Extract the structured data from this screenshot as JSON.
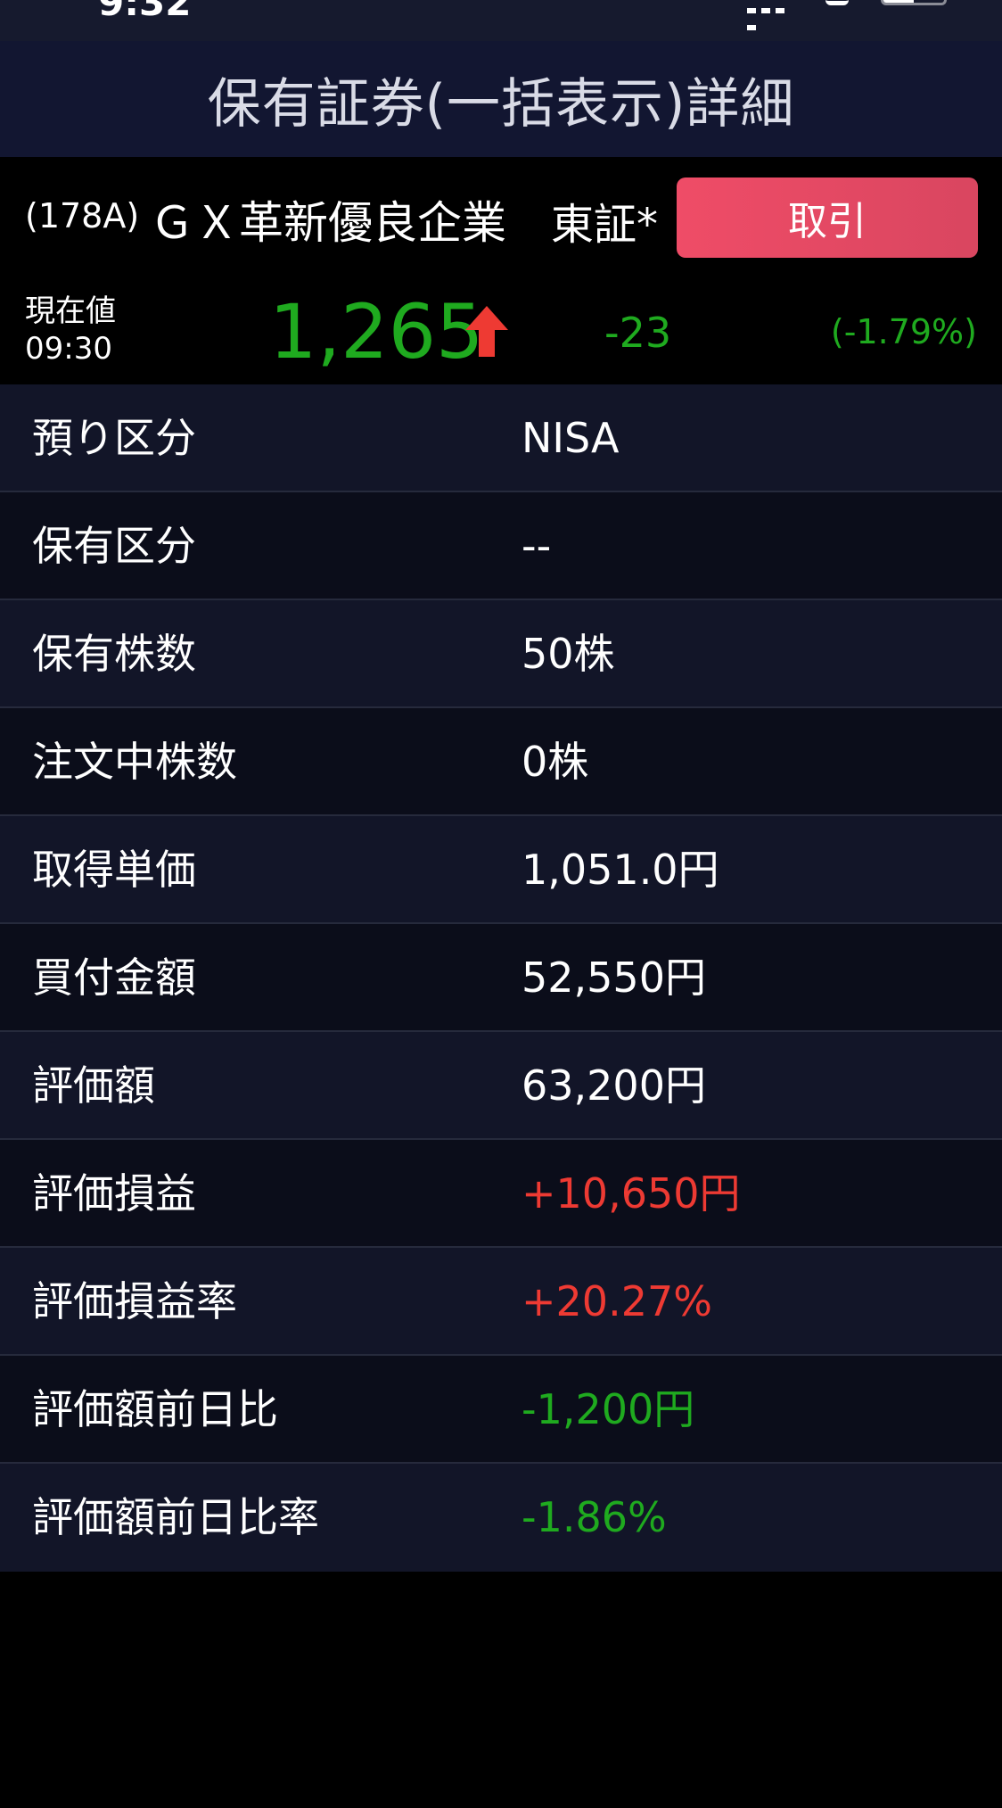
{
  "status_bar": {
    "time": "9:32"
  },
  "header": {
    "title": "保有証券(一括表示)詳細"
  },
  "stock": {
    "code": "(178A)",
    "name": "ＧＸ革新優良企業",
    "market": "東証*",
    "trade_button_label": "取引",
    "price_label": "現在値",
    "price_time": "09:30",
    "current_price": "1,265",
    "price_direction_icon": "up-arrow-icon",
    "change": "-23",
    "change_pct": "(-1.79%)",
    "colors": {
      "down": "#1faa1f",
      "up": "#ee3a33",
      "trade_button": "#ef4c67"
    }
  },
  "details": [
    {
      "label": "預り区分",
      "value": "NISA",
      "tone": "neutral"
    },
    {
      "label": "保有区分",
      "value": "--",
      "tone": "neutral"
    },
    {
      "label": "保有株数",
      "value": "50株",
      "tone": "neutral"
    },
    {
      "label": "注文中株数",
      "value": "0株",
      "tone": "neutral"
    },
    {
      "label": "取得単価",
      "value": "1,051.0円",
      "tone": "neutral"
    },
    {
      "label": "買付金額",
      "value": "52,550円",
      "tone": "neutral"
    },
    {
      "label": "評価額",
      "value": "63,200円",
      "tone": "neutral"
    },
    {
      "label": "評価損益",
      "value": "+10,650円",
      "tone": "red"
    },
    {
      "label": "評価損益率",
      "value": "+20.27%",
      "tone": "red"
    },
    {
      "label": "評価額前日比",
      "value": "-1,200円",
      "tone": "green"
    },
    {
      "label": "評価額前日比率",
      "value": "-1.86%",
      "tone": "green"
    }
  ]
}
